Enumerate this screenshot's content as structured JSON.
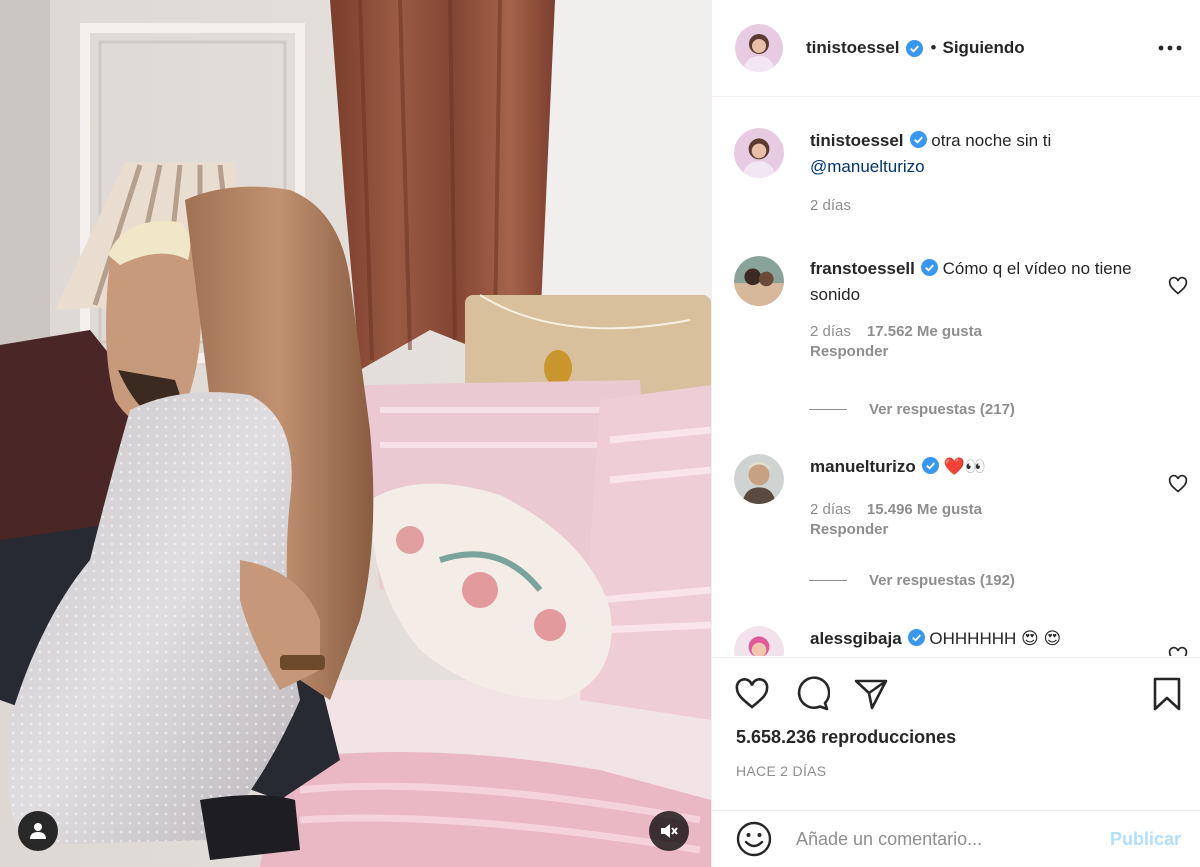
{
  "colors": {
    "link": "#00376b",
    "verified": "#3897f0",
    "muted": "#8e8e8e",
    "post_disabled": "#b2dffc"
  },
  "media": {
    "tag_icon": "user-icon",
    "mute_icon": "speaker-muted-icon"
  },
  "header": {
    "username": "tinistoessel",
    "separator": "•",
    "follow_status": "Siguiendo",
    "more_icon": "more-horizontal-icon"
  },
  "caption": {
    "username": "tinistoessel",
    "text": "otra noche sin ti",
    "mention": "@manuelturizo",
    "time": "2 días"
  },
  "comments": [
    {
      "username": "franstoessell",
      "text": "Cómo q el vídeo no tiene sonido",
      "time": "2 días",
      "likes": "17.562 Me gusta",
      "reply": "Responder",
      "view_replies": "Ver respuestas (217)"
    },
    {
      "username": "manuelturizo",
      "text": "❤️👀",
      "time": "2 días",
      "likes": "15.496 Me gusta",
      "reply": "Responder",
      "view_replies": "Ver respuestas (192)"
    },
    {
      "username": "alessgibaja",
      "text": "OHHHHHH 😍 😍"
    }
  ],
  "stats": {
    "views": "5.658.236 reproducciones",
    "posted": "HACE 2 DÍAS"
  },
  "add_comment": {
    "placeholder": "Añade un comentario...",
    "post_label": "Publicar"
  }
}
